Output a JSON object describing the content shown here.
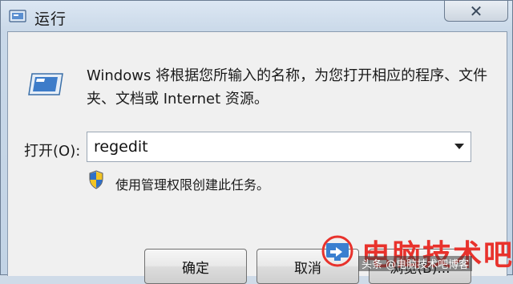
{
  "window": {
    "title": "运行",
    "close_glyph": "✕"
  },
  "dialog": {
    "description": "Windows 将根据您所输入的名称，为您打开相应的程序、文件夹、文档或 Internet 资源。",
    "open_label": "打开(O):",
    "input_value": "regedit",
    "admin_note": "使用管理权限创建此任务。"
  },
  "buttons": {
    "ok": "确定",
    "cancel": "取消",
    "browse": "浏览(B)..."
  },
  "watermark": {
    "brand": "电脑技术吧",
    "subtitle": "头条 @电脑技术吧博客"
  },
  "icons": {
    "app": "run-icon",
    "close": "close-icon",
    "dropdown": "chevron-down-icon",
    "shield": "uac-shield-icon"
  },
  "colors": {
    "title_bar": "#c9d8e8",
    "client_bg": "#f0f0f0",
    "watermark_red": "#e8322c"
  }
}
